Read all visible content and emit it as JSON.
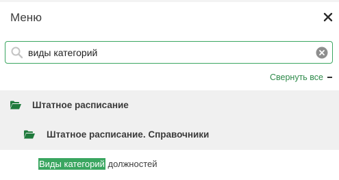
{
  "menu": {
    "title": "Меню",
    "search": {
      "value": "виды категорий",
      "placeholder": ""
    },
    "collapse_all_label": "Свернуть все",
    "tree": [
      {
        "label": "Штатное расписание",
        "icon": "folder-open-icon"
      },
      {
        "label": "Штатное расписание. Справочники",
        "icon": "folder-open-icon"
      }
    ],
    "leaf": {
      "highlight": "Виды категорий",
      "rest": " должностей"
    }
  },
  "colors": {
    "accent": "#3aa660",
    "link": "#2e8a4a",
    "row_bg": "#f0f0f0"
  }
}
